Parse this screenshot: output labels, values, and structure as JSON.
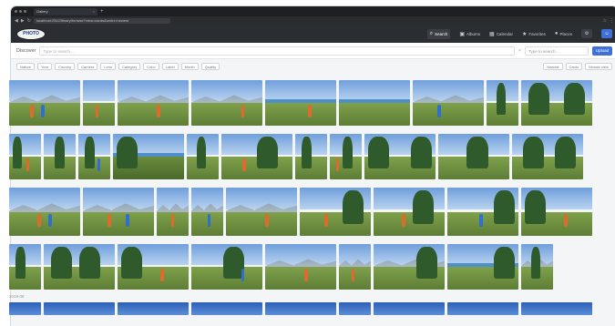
{
  "browser": {
    "tab_title": "Gallery",
    "url": "localhost:2342/library/browse?view=cards&order=newest",
    "new_tab_symbol": "+"
  },
  "app": {
    "logo_text": "PHOTO",
    "nav": [
      {
        "label": "Search",
        "icon": "search-icon",
        "active": true
      },
      {
        "label": "Albums",
        "icon": "album-icon",
        "active": false
      },
      {
        "label": "Calendar",
        "icon": "calendar-icon",
        "active": false
      },
      {
        "label": "Favorites",
        "icon": "star-icon",
        "active": false
      },
      {
        "label": "Places",
        "icon": "pin-icon",
        "active": false
      }
    ]
  },
  "search": {
    "title": "Discover",
    "placeholder": "Type to search…",
    "select_placeholder": "Type to search…",
    "button_label": "Upload"
  },
  "filters": {
    "chips": [
      "Nature",
      "Year",
      "Country",
      "Camera",
      "Lens",
      "Category",
      "Color",
      "Label",
      "Month",
      "Quality"
    ],
    "right": [
      "Newest",
      "Cards",
      "Mosaic view"
    ]
  },
  "section_label": "2019-08",
  "colors": {
    "app_bar": "#2a2e33",
    "accent": "#3f6fd8",
    "page_bg": "#f4f5f7"
  }
}
